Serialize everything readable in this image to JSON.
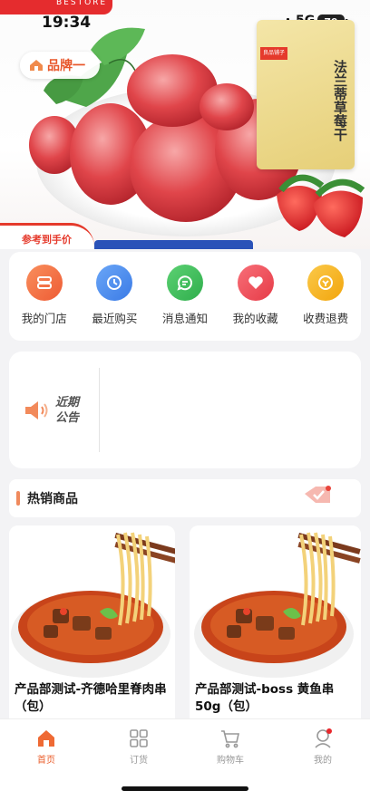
{
  "status_bar": {
    "time": "19:34",
    "network": "5G",
    "battery": "79"
  },
  "hero": {
    "brand_ribbon": "BESTORE",
    "brand_selector": "品牌一",
    "package_text": "法兰蒂草莓干",
    "package_brand": "良品铺子",
    "reference_price_badge": "参考到手价"
  },
  "quick_nav": [
    {
      "label": "我的门店",
      "icon": "store-icon",
      "color": "#f4713f"
    },
    {
      "label": "最近购买",
      "icon": "clock-icon",
      "color": "#4b8ef0"
    },
    {
      "label": "消息通知",
      "icon": "message-icon",
      "color": "#3fbf5c"
    },
    {
      "label": "我的收藏",
      "icon": "heart-icon",
      "color": "#ef4a54"
    },
    {
      "label": "收费退费",
      "icon": "refund-icon",
      "color": "#f4b31c"
    }
  ],
  "notice": {
    "title": "近期公告"
  },
  "hot_section": {
    "title": "热销商品"
  },
  "products": [
    {
      "title": "产品部测试-齐德哈里脊肉串（包）"
    },
    {
      "title": "产品部测试-boss 黄鱼串50g（包）"
    }
  ],
  "tabbar": [
    {
      "label": "首页",
      "icon": "home-icon",
      "active": true
    },
    {
      "label": "订货",
      "icon": "grid-icon",
      "active": false
    },
    {
      "label": "购物车",
      "icon": "cart-icon",
      "active": false
    },
    {
      "label": "我的",
      "icon": "user-icon",
      "active": false,
      "badge": true
    }
  ],
  "colors": {
    "accent": "#ea5c2a",
    "ribbon": "#e52c2e"
  }
}
